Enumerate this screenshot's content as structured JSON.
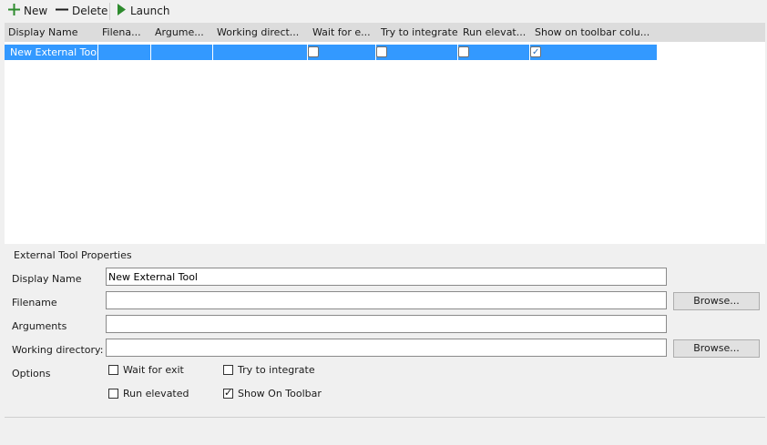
{
  "toolbar": {
    "new_label": "New",
    "delete_label": "Delete",
    "launch_label": "Launch"
  },
  "grid": {
    "columns": [
      "Display Name",
      "Filena...",
      "Argume...",
      "Working direct...",
      "Wait for e...",
      "Try to integrate",
      "Run elevat...",
      "Show on toolbar colu..."
    ],
    "rows": [
      {
        "display_name": "New External Tool",
        "filename": "",
        "arguments": "",
        "working_directory": "",
        "wait_for_exit": false,
        "try_to_integrate": false,
        "run_elevated": false,
        "show_on_toolbar": true
      }
    ]
  },
  "properties": {
    "group_title": "External Tool Properties",
    "display_name_label": "Display Name",
    "display_name_value": "New External Tool",
    "filename_label": "Filename",
    "filename_value": "",
    "arguments_label": "Arguments",
    "arguments_value": "",
    "working_directory_label": "Working directory:",
    "working_directory_value": "",
    "browse_label": "Browse...",
    "options_label": "Options",
    "options": {
      "wait_for_exit": {
        "label": "Wait for exit",
        "checked": false
      },
      "try_to_integrate": {
        "label": "Try to integrate",
        "checked": false
      },
      "run_elevated": {
        "label": "Run elevated",
        "checked": false
      },
      "show_on_toolbar": {
        "label": "Show On Toolbar",
        "checked": true
      }
    }
  },
  "colors": {
    "selection": "#3399ff",
    "header": "#dcdcdc",
    "plus_icon": "#2e8b2e",
    "launch_icon": "#2e8b2e"
  }
}
